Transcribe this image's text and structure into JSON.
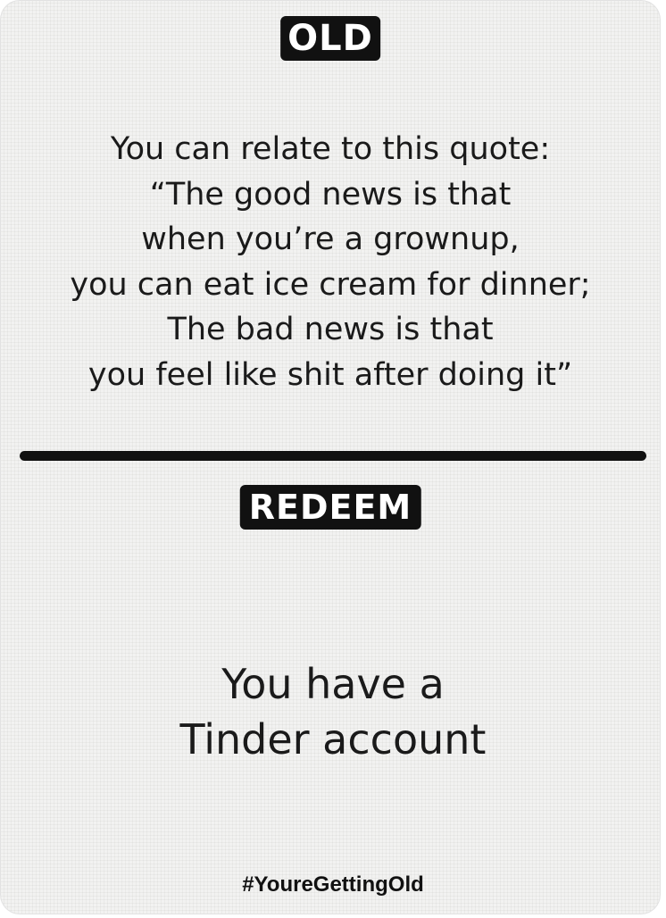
{
  "card": {
    "top_label": "OLD",
    "quote_lines": [
      "You can relate to this quote:",
      "“The good news is that",
      "when you’re a grownup,",
      "you can eat ice cream for dinner;",
      "The bad news is that",
      "you feel like shit after doing it”"
    ],
    "bottom_label": "REDEEM",
    "redeem_lines": [
      "You have a",
      "Tinder account"
    ],
    "hashtag": "#YoureGettingOld"
  }
}
